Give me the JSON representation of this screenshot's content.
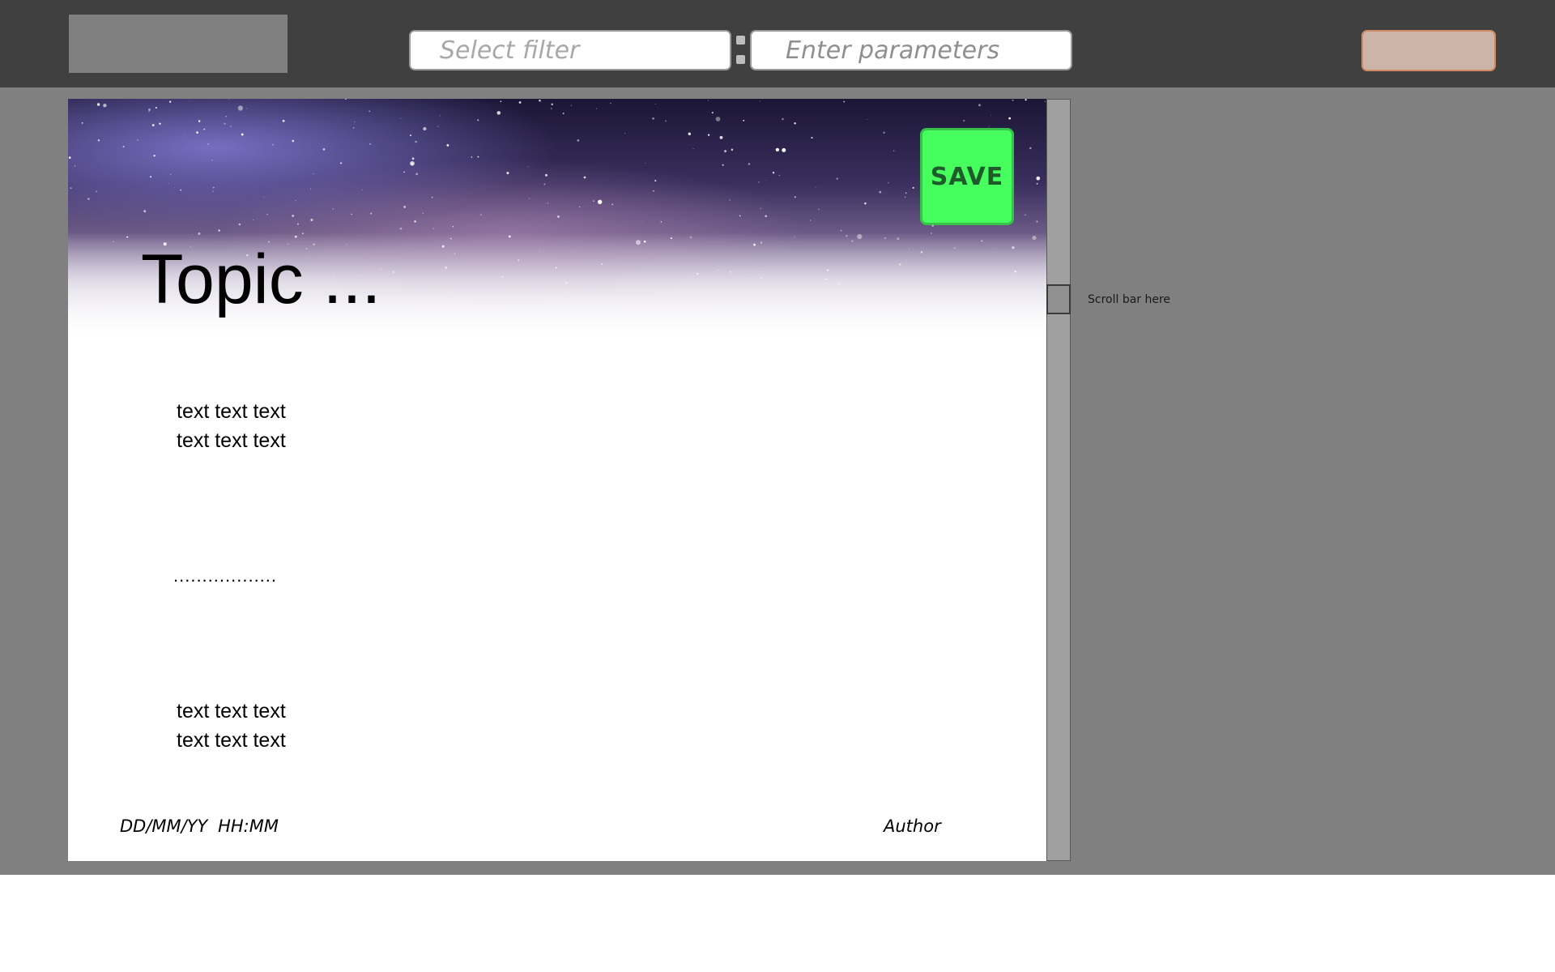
{
  "header": {
    "filter_placeholder": "Select filter",
    "parameters_placeholder": "Enter parameters",
    "action_button_label": ""
  },
  "article": {
    "save_label": "SAVE",
    "topic": "Topic ...",
    "paragraph_1": [
      "text text text",
      "text text text"
    ],
    "ellipsis": "..................",
    "paragraph_2": [
      "text text text",
      "text text text"
    ],
    "date": "DD/MM/YY",
    "time": "HH:MM",
    "author": "Author"
  },
  "scrollbar": {
    "note": "Scroll bar here"
  },
  "colors": {
    "topbar": "#404040",
    "workspace": "#808080",
    "save_button": "#46fe5e",
    "action_button": "#ccb5a8"
  },
  "icons": {
    "hero_image": "starry-night-sky-banner"
  }
}
